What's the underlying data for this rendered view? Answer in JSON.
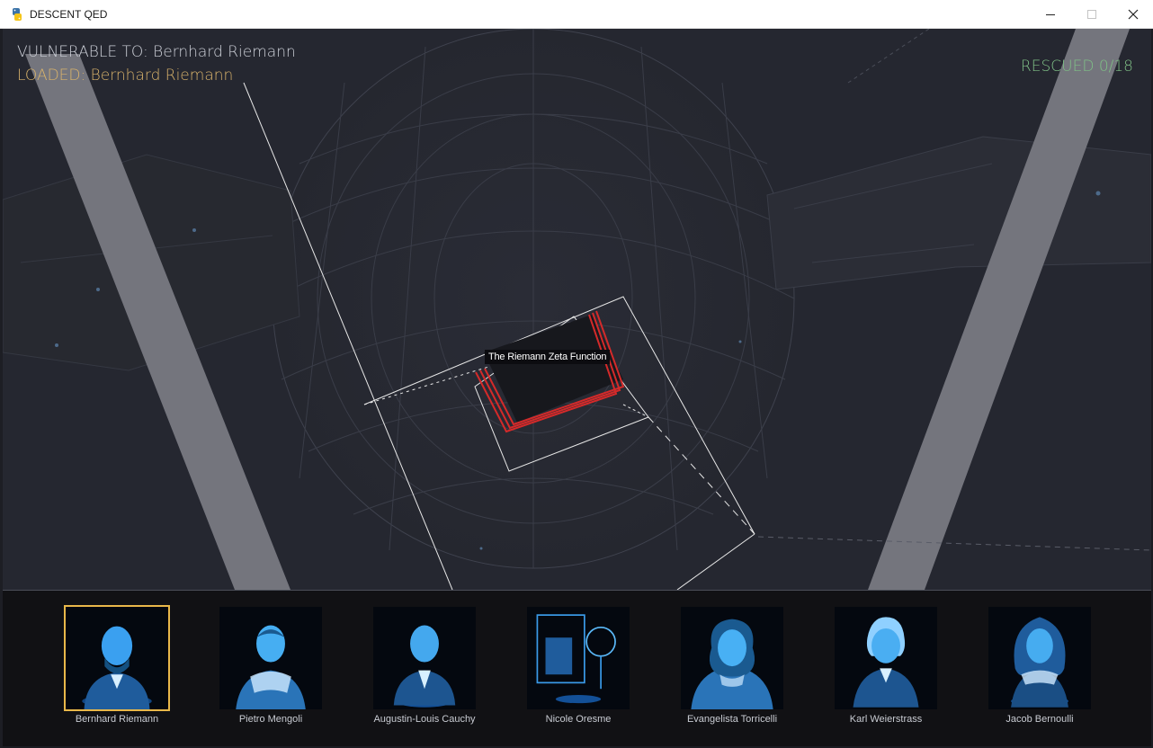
{
  "window": {
    "title": "DESCENT QED",
    "icon": "python-icon",
    "controls": [
      "minimize-icon",
      "maximize-icon",
      "close-icon"
    ]
  },
  "hud": {
    "vulnerable_label": "VULNERABLE TO: Bernhard Riemann",
    "loaded_label": "LOADED: Bernhard Riemann",
    "rescued_label": "RESCUED 0/18"
  },
  "target": {
    "tooltip": "The Riemann Zeta Function"
  },
  "colors": {
    "vulnerable": "#cdd0d8",
    "loaded": "#d9b36b",
    "rescued": "#7fbf86",
    "target_outline": "#d42a2a",
    "selection": "#e9b84a",
    "hologram": "#38a8ff"
  },
  "roster": [
    {
      "name": "Bernhard Riemann",
      "selected": true
    },
    {
      "name": "Pietro Mengoli",
      "selected": false
    },
    {
      "name": "Augustin-Louis Cauchy",
      "selected": false
    },
    {
      "name": "Nicole Oresme",
      "selected": false
    },
    {
      "name": "Evangelista Torricelli",
      "selected": false
    },
    {
      "name": "Karl Weierstrass",
      "selected": false
    },
    {
      "name": "Jacob Bernoulli",
      "selected": false
    }
  ]
}
